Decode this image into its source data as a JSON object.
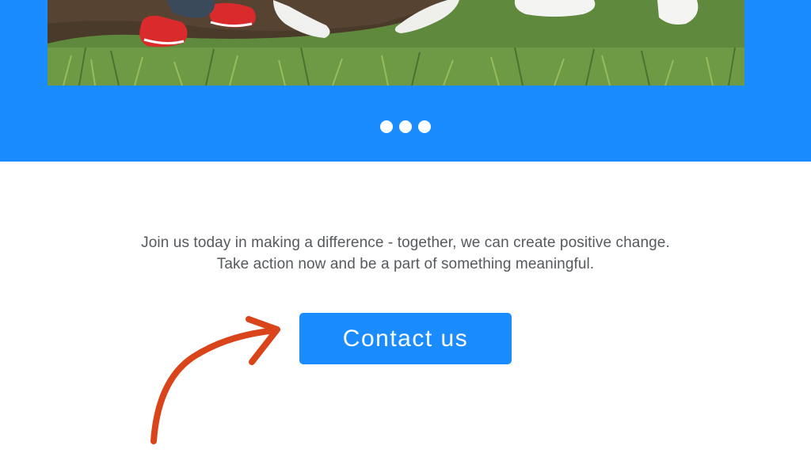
{
  "hero": {
    "photo_description_icon": "volunteers-planting-photo",
    "band_color": "#1a8cff",
    "carousel_dots": [
      {
        "label": "slide-1"
      },
      {
        "label": "slide-2"
      },
      {
        "label": "slide-3"
      }
    ]
  },
  "cta": {
    "tagline_line1": "Join us today in making a difference - together, we can create positive change.",
    "tagline_line2": "Take action now and be a part of something meaningful.",
    "button_label": "Contact us",
    "button_color": "#1a8cff",
    "arrow_icon": "curved-arrow-icon",
    "arrow_color": "#d9441a"
  }
}
